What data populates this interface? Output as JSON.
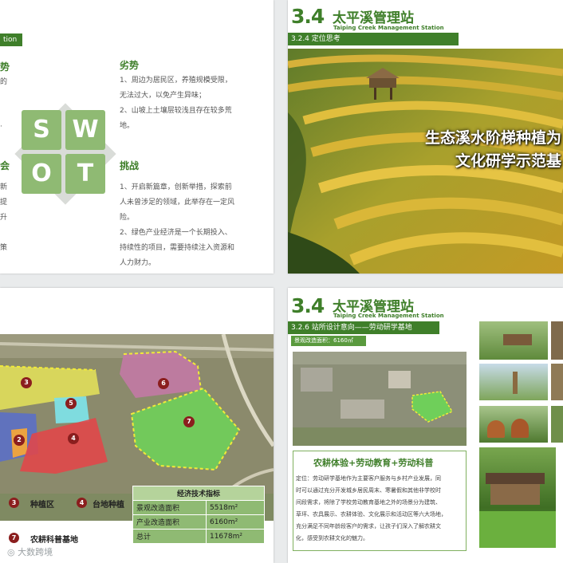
{
  "slide1": {
    "bar_text": "tion",
    "left_heading_1": "势",
    "left_frag_1": "的",
    "left_heading_2": "会",
    "left_frag_2": "新",
    "left_frag_3": "提",
    "left_frag_4": "升",
    "left_frag_5": "策",
    "weakness_heading": "劣势",
    "weakness_lines": [
      "1、周边为居民区，养殖规模受限，",
      "无法过大，以免产生异味；",
      "2、山坡上土壤层较浅且存在较多荒",
      "地。"
    ],
    "threat_heading": "挑战",
    "threat_lines": [
      "1、开启新篇章，创新举措，探索前",
      "人未曾涉足的领域，此举存在一定风",
      "险。",
      "2、绿色产业经济是一个长期投入、",
      "持续性的项目，需要持续注入资源和",
      "人力财力。"
    ],
    "swot": [
      "S",
      "W",
      "O",
      "T"
    ]
  },
  "slide2": {
    "num": "3.4",
    "title_cn": "太平溪管理站",
    "title_en": "Taiping Creek Management Station",
    "bar": "3.2.4  定位思考",
    "overlay_line1": "生态溪水阶梯种植为",
    "overlay_line2": "文化研学示范基"
  },
  "slide3": {
    "zones": [
      "3",
      "6",
      "5",
      "2",
      "4",
      "7"
    ],
    "table_title": "经济技术指标",
    "table_rows": [
      {
        "label": "景观改造面积",
        "value": "5518m²"
      },
      {
        "label": "产业改造面积",
        "value": "6160m²"
      },
      {
        "label": "总计",
        "value": "11678m²"
      }
    ],
    "legend": [
      {
        "num": "3",
        "text": "种植区"
      },
      {
        "num": "4",
        "text": "台地种植"
      },
      {
        "num": "7",
        "text": "农耕科普基地"
      }
    ],
    "watermark": "大数跨境"
  },
  "slide4": {
    "num": "3.4",
    "title_cn": "太平溪管理站",
    "title_en": "Taiping Creek Management Station",
    "bar": "3.2.6  站所设计意向——劳动研学基地",
    "sub_bar": "景观改造面积：6160㎡",
    "box_title": "农耕体验+劳动教育+劳动科普",
    "box_lines": [
      "定位：劳动研学基地作为主要客户服务与乡村产业发展，同",
      "时可以通过充分开发城乡居民周末、寒暑假和其他非学校时",
      "间段需求，将除了学校劳动教育基地之外的场景分为建筑、",
      "草坪、农具展示、农耕体验、文化展示和活动区等六大场地，",
      "充分满足不同年龄段客户的需求，让孩子们深入了解农耕文",
      "化，感受到农耕文化的魅力。"
    ]
  },
  "colors": {
    "brand_green": "#3f7f2a",
    "swot_green": "#8fba73"
  }
}
